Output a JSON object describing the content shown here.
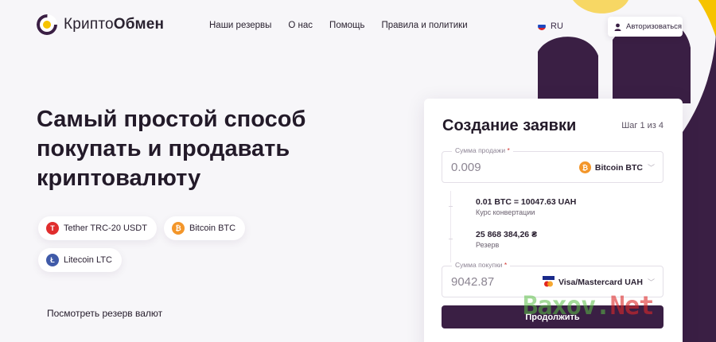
{
  "brand": {
    "name_light": "Крипто",
    "name_bold": "Обмен"
  },
  "nav": [
    {
      "label": "Наши резервы"
    },
    {
      "label": "О нас"
    },
    {
      "label": "Помощь"
    },
    {
      "label": "Правила и политики"
    }
  ],
  "lang": {
    "code": "RU"
  },
  "header": {
    "login_label": "Авторизоваться"
  },
  "hero": {
    "title": "Самый простой способ покупать и продавать криптовалюту",
    "coins": [
      {
        "label": "Tether TRC-20 USDT",
        "icon": "tether-icon",
        "color": "#e02d2d"
      },
      {
        "label": "Bitcoin BTC",
        "icon": "bitcoin-icon",
        "color": "#f3962a"
      },
      {
        "label": "Litecoin LTC",
        "icon": "litecoin-icon",
        "color": "#3f5aa8"
      }
    ],
    "reserve_link": "Посмотреть резерв валют"
  },
  "form": {
    "title": "Создание заявки",
    "step": "Шаг 1 из 4",
    "sell": {
      "label": "Сумма продажи",
      "required_mark": "*",
      "value": "0.009",
      "currency": "Bitcoin BTC"
    },
    "rate": {
      "value": "0.01 BTC = 10047.63 UAH",
      "caption": "Курс конвертации"
    },
    "reserve": {
      "value": "25 868 384,26 ₴",
      "caption": "Резерв"
    },
    "buy": {
      "label": "Сумма покупки",
      "required_mark": "*",
      "value": "9042.87",
      "currency": "Visa/Mastercard UAH"
    },
    "submit_label": "Продолжить"
  },
  "watermark": {
    "text_a": "Baxov.",
    "text_b": "Net"
  },
  "colors": {
    "accent_dark": "#3a1f44",
    "accent_yellow": "#f6c300",
    "bitcoin": "#f3962a"
  }
}
